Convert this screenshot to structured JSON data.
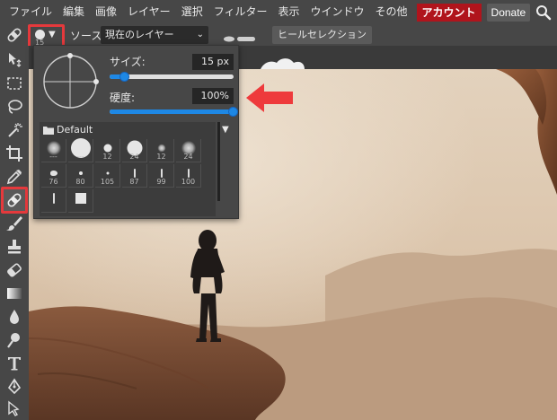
{
  "menu": {
    "items": [
      "ファイル",
      "編集",
      "画像",
      "レイヤー",
      "選択",
      "フィルター",
      "表示",
      "ウインドウ",
      "その他"
    ],
    "account": "アカウント",
    "donate": "Donate"
  },
  "options": {
    "brush_size": "15",
    "source_label": "ソース:",
    "source_value": "現在のレイヤー",
    "heal_selection": "ヒールセレクション"
  },
  "popup": {
    "size_label": "サイズ:",
    "size_value": "15  px",
    "size_fraction": 0.12,
    "hardness_label": "硬度:",
    "hardness_value": "100%",
    "hardness_fraction": 1.0,
    "preset_folder": "Default",
    "presets": [
      {
        "label": "---",
        "shape": "soft",
        "d": 16
      },
      {
        "label": "---",
        "shape": "hard",
        "d": 22
      },
      {
        "label": "12",
        "shape": "hard",
        "d": 9
      },
      {
        "label": "24",
        "shape": "hard",
        "d": 17
      },
      {
        "label": "12",
        "shape": "soft",
        "d": 9
      },
      {
        "label": "24",
        "shape": "soft",
        "d": 16
      },
      {
        "label": "76",
        "shape": "blot",
        "d": 8
      },
      {
        "label": "80",
        "shape": "hard",
        "d": 4
      },
      {
        "label": "105",
        "shape": "hard",
        "d": 3
      },
      {
        "label": "87",
        "shape": "line",
        "d": 10
      },
      {
        "label": "99",
        "shape": "line",
        "d": 10
      },
      {
        "label": "100",
        "shape": "line",
        "d": 10
      },
      {
        "label": "",
        "shape": "line",
        "d": 12
      },
      {
        "label": "",
        "shape": "square",
        "d": 12
      }
    ]
  },
  "colors": {
    "highlight": "#e5393c",
    "accent": "#1e88e5",
    "account_bg": "#b0141c"
  },
  "toolbar": {
    "tools": [
      {
        "name": "move-tool",
        "icon": "move-icon"
      },
      {
        "name": "marquee-tool",
        "icon": "marquee-icon"
      },
      {
        "name": "lasso-tool",
        "icon": "lasso-icon"
      },
      {
        "name": "magic-wand-tool",
        "icon": "magic-wand-icon"
      },
      {
        "name": "crop-tool",
        "icon": "crop-icon"
      },
      {
        "name": "eyedropper-tool",
        "icon": "eyedropper-icon"
      },
      {
        "name": "spot-heal-tool",
        "icon": "bandage-icon",
        "active": true
      },
      {
        "name": "brush-tool",
        "icon": "brush-icon"
      },
      {
        "name": "clone-stamp-tool",
        "icon": "stamp-icon"
      },
      {
        "name": "eraser-tool",
        "icon": "eraser-icon"
      },
      {
        "name": "gradient-tool",
        "icon": "gradient-icon"
      },
      {
        "name": "blur-tool",
        "icon": "drop-icon"
      },
      {
        "name": "dodge-tool",
        "icon": "dodge-icon"
      },
      {
        "name": "text-tool",
        "icon": "text-icon"
      },
      {
        "name": "pen-tool",
        "icon": "pen-icon"
      },
      {
        "name": "path-select-tool",
        "icon": "path-select-icon"
      }
    ]
  }
}
